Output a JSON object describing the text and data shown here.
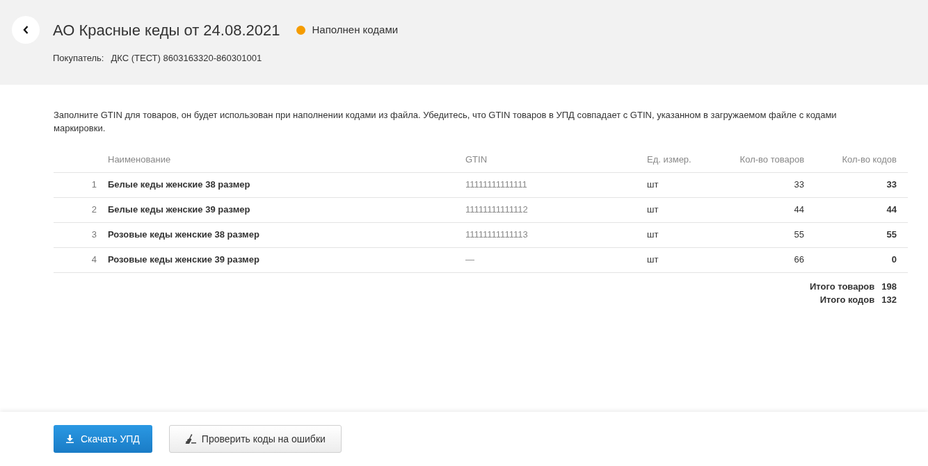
{
  "header": {
    "title": "АО Красные кеды от 24.08.2021",
    "status": {
      "label": "Наполнен кодами",
      "color": "#f59c00"
    },
    "buyer_label": "Покупатель:",
    "buyer_value": "ДКС (ТЕСТ) 8603163320-860301001"
  },
  "notice": "Заполните GTIN для товаров, он будет использован при наполнении кодами из файла. Убедитесь, что GTIN товаров в УПД совпадает с GTIN, указанном в загружаемом файле с кодами маркировки.",
  "table": {
    "columns": [
      "Наименование",
      "GTIN",
      "Ед. измер.",
      "Кол-во товаров",
      "Кол-во кодов"
    ],
    "rows": [
      {
        "index": "1",
        "name": "Белые кеды женские 38 размер",
        "gtin": "11111111111111",
        "unit": "шт",
        "goods": "33",
        "codes": "33"
      },
      {
        "index": "2",
        "name": "Белые кеды женские 39 размер",
        "gtin": "11111111111112",
        "unit": "шт",
        "goods": "44",
        "codes": "44"
      },
      {
        "index": "3",
        "name": "Розовые кеды женские 38 размер",
        "gtin": "11111111111113",
        "unit": "шт",
        "goods": "55",
        "codes": "55"
      },
      {
        "index": "4",
        "name": "Розовые кеды женские 39 размер",
        "gtin": "—",
        "unit": "шт",
        "goods": "66",
        "codes": "0"
      }
    ],
    "totals": [
      {
        "label": "Итого товаров",
        "value": "198"
      },
      {
        "label": "Итого кодов",
        "value": "132"
      }
    ]
  },
  "buttons": [
    {
      "kind": "primary",
      "label": "Скачать УПД"
    },
    {
      "kind": "secondary",
      "label": "Проверить коды на ошибки"
    }
  ]
}
